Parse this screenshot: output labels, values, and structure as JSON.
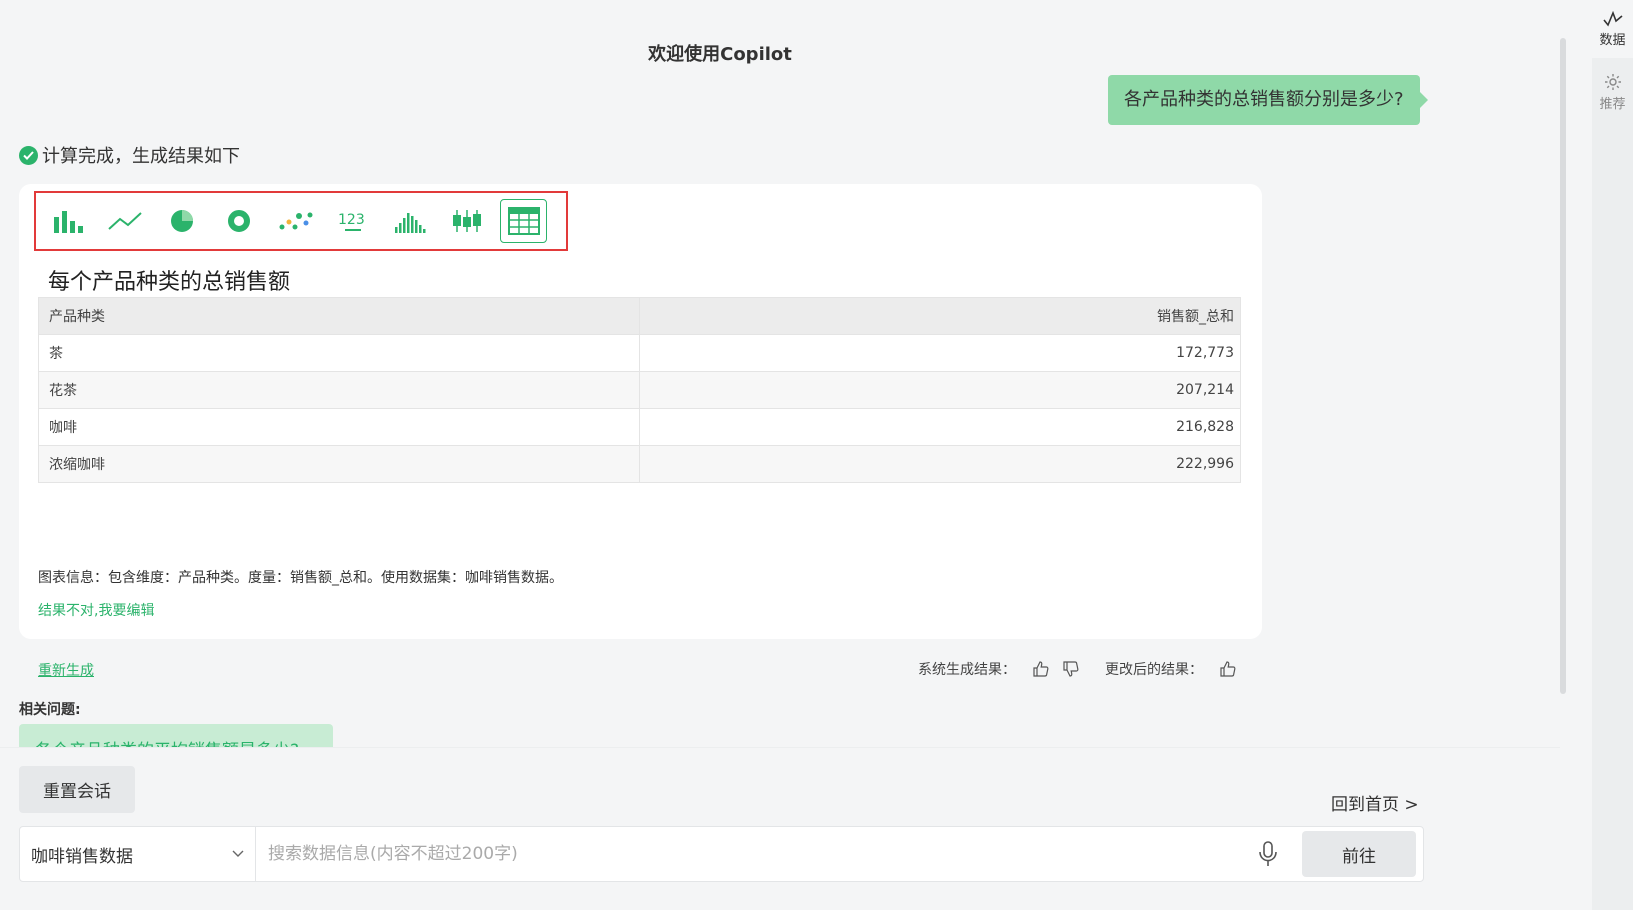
{
  "header": {
    "title": "欢迎使用Copilot"
  },
  "conversation": {
    "user_question": "各产品种类的总销售额分别是多少?",
    "status": "计算完成，生成结果如下"
  },
  "chart_types": [
    {
      "name": "bar"
    },
    {
      "name": "line"
    },
    {
      "name": "pie"
    },
    {
      "name": "donut"
    },
    {
      "name": "scatter"
    },
    {
      "name": "number"
    },
    {
      "name": "histogram"
    },
    {
      "name": "boxplot"
    },
    {
      "name": "table",
      "active": true
    }
  ],
  "result": {
    "title": "每个产品种类的总销售额",
    "columns": [
      "产品种类",
      "销售额_总和"
    ],
    "rows": [
      [
        "茶",
        "172,773"
      ],
      [
        "花茶",
        "207,214"
      ],
      [
        "咖啡",
        "216,828"
      ],
      [
        "浓缩咖啡",
        "222,996"
      ]
    ],
    "info": "图表信息：包含维度：产品种类。度量：销售额_总和。使用数据集：咖啡销售数据。",
    "edit_link": "结果不对,我要编辑"
  },
  "chart_data": {
    "type": "table",
    "columns": [
      "产品种类",
      "销售额_总和"
    ],
    "categories": [
      "茶",
      "花茶",
      "咖啡",
      "浓缩咖啡"
    ],
    "values": [
      172773,
      207214,
      216828,
      222996
    ],
    "title": "每个产品种类的总销售额"
  },
  "actions": {
    "regenerate": "重新生成",
    "system_result_label": "系统生成结果：",
    "modified_result_label": "更改后的结果："
  },
  "related": {
    "label": "相关问题:",
    "items": [
      "各个产品种类的平均销售额是多少?"
    ]
  },
  "footer": {
    "reset": "重置会话",
    "home": "回到首页 >",
    "dataset": "咖啡销售数据",
    "search_placeholder": "搜索数据信息(内容不超过200字)",
    "go": "前往"
  },
  "rail": {
    "data": "数据",
    "recommend": "推荐"
  },
  "colors": {
    "accent": "#2bb36b",
    "user_bubble": "#8fd9a8",
    "highlight_border": "#e23a3a"
  }
}
